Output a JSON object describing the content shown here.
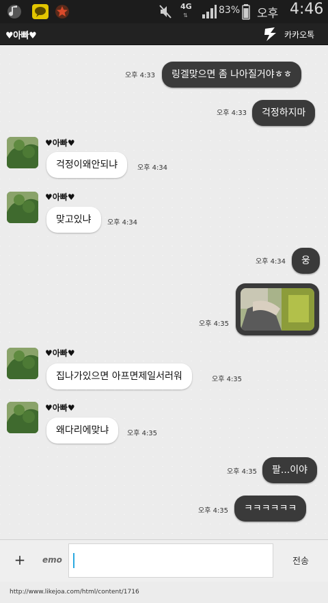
{
  "status_bar": {
    "network": "4G",
    "battery": "83%",
    "ampm": "오후",
    "time": "4:46",
    "icons": [
      "music-icon",
      "kakaotalk-icon",
      "star-icon",
      "mute-icon",
      "signal-icon",
      "battery-icon"
    ]
  },
  "header": {
    "title": "♥아빠♥",
    "app_name": "카카오톡",
    "logo_icon": "kakao-bolt-icon"
  },
  "messages": [
    {
      "side": "out",
      "text": "링겔맞으면 좀 나아질거야ㅎㅎ",
      "time": "오후 4:33"
    },
    {
      "side": "out",
      "text": "걱정하지마",
      "time": "오후 4:33"
    },
    {
      "side": "in",
      "sender": "♥아빠♥",
      "text": "걱정이왜안되냐",
      "time": "오후 4:34"
    },
    {
      "side": "in",
      "sender": "♥아빠♥",
      "text": "맞고있냐",
      "time": "오후 4:34"
    },
    {
      "side": "out",
      "text": "웅",
      "time": "오후 4:34"
    },
    {
      "side": "out",
      "type": "photo",
      "time": "오후 4:35"
    },
    {
      "side": "in",
      "sender": "♥아빠♥",
      "text": "집나가있으면 아프면제일서러워",
      "time": "오후 4:35"
    },
    {
      "side": "in",
      "sender": "♥아빠♥",
      "text": "왜다리에맞냐",
      "time": "오후 4:35"
    },
    {
      "side": "out",
      "text": "팔...이야",
      "time": "오후 4:35"
    },
    {
      "side": "out",
      "text": "ㅋㅋㅋㅋㅋㅋ",
      "time": "오후 4:35"
    }
  ],
  "input": {
    "plus_label": "+",
    "emo_label": "emo",
    "value": "",
    "send_label": "전송"
  },
  "footer": {
    "url": "http://www.likejoa.com/html/content/1716"
  },
  "colors": {
    "outgoing_bubble": "#3a3a3a",
    "incoming_bubble": "#ffffff",
    "header_bg": "#222222",
    "status_bg": "#1c1c1c",
    "cursor": "#2aa8e0"
  }
}
